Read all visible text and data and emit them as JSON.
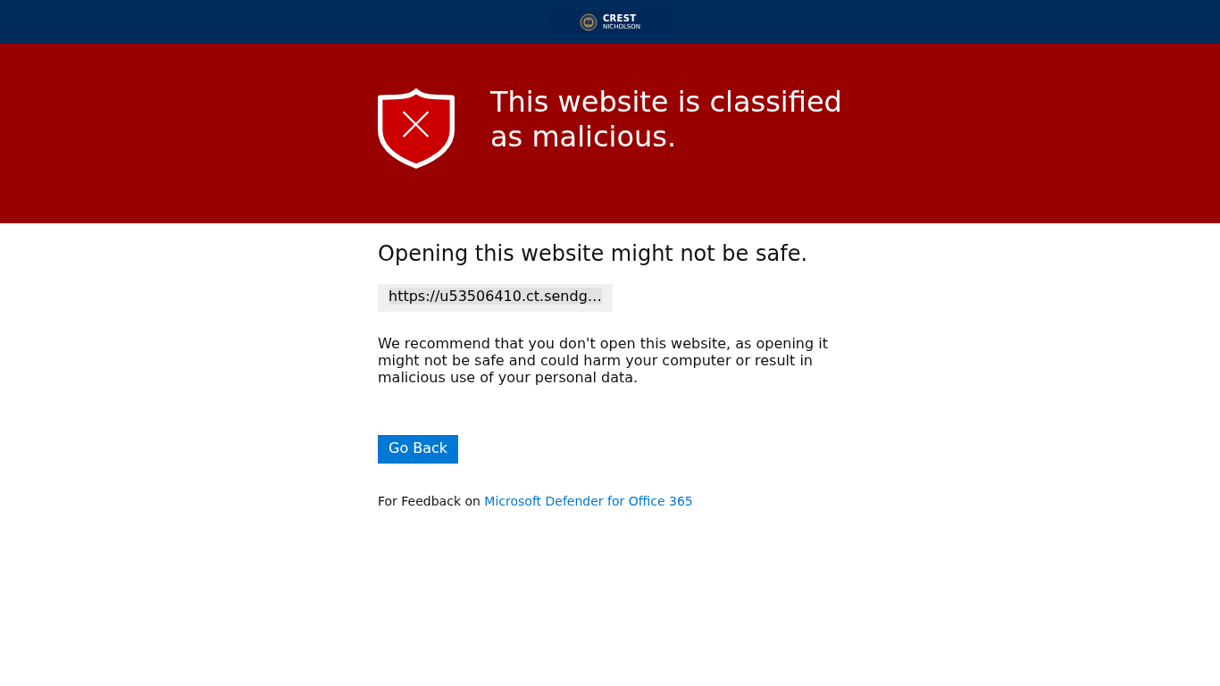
{
  "header": {
    "logo": {
      "name": "CREST",
      "subtitle": "NICHOLSON"
    }
  },
  "banner": {
    "title": "This website is classified as malicious."
  },
  "content": {
    "heading": "Opening this website might not be safe.",
    "url": "https://u53506410.ct.sendg…",
    "message": "We recommend that you don't open this website, as opening it might not be safe and could harm your computer or result in malicious use of your personal data.",
    "button": "Go Back",
    "feedback": {
      "text": "For Feedback on",
      "link": "Microsoft Defender for Office 365"
    }
  }
}
